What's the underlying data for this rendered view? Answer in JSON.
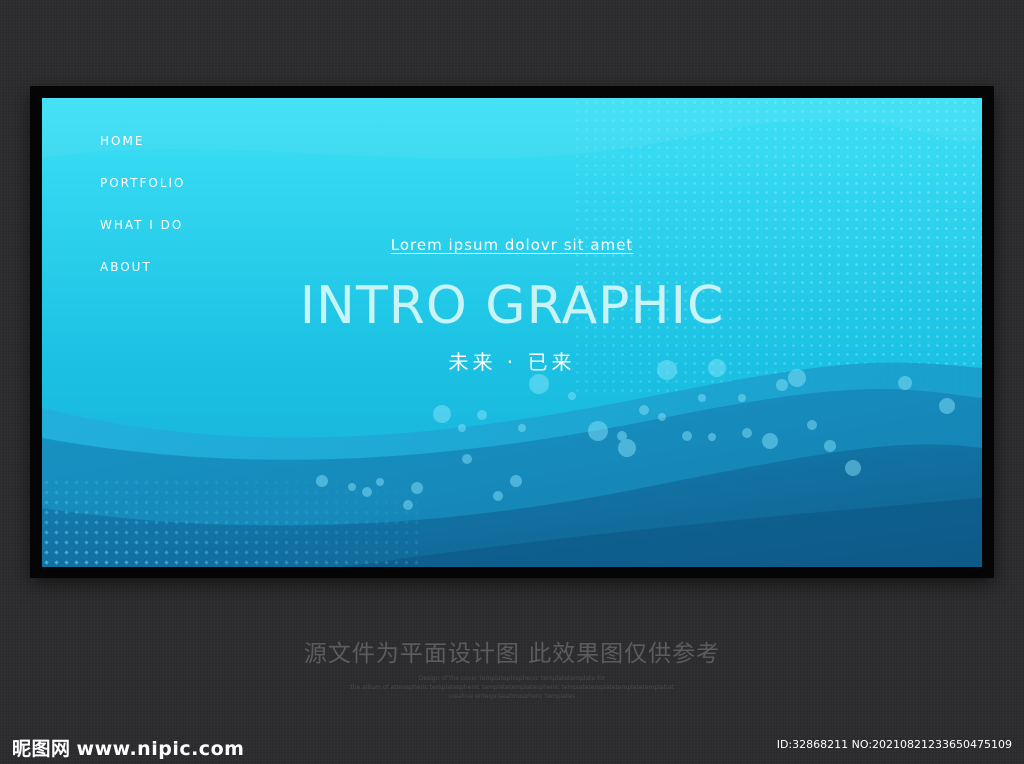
{
  "nav": {
    "items": [
      {
        "label": "HOME"
      },
      {
        "label": "PORTFOLIO"
      },
      {
        "label": "WHAT I DO"
      },
      {
        "label": "ABOUT"
      }
    ]
  },
  "hero": {
    "tagline": "Lorem ipsum dolovr sit amet",
    "title": "INTRO GRAPHIC",
    "subtitle": "未来 · 已来"
  },
  "footer": {
    "caption": "源文件为平面设计图 此效果图仅供参考",
    "fine_print": [
      "Design of the cover templatephisphenic templatetemplate for",
      "the album of atmospheric templatesphenic templatetemplatesphenic templatetemplatetemplatetemplatiat",
      "creative enterpriseatmospheric templates"
    ]
  },
  "watermark": {
    "logo_text": "昵图网",
    "url": "www.nipic.com",
    "image_id": "ID:32868211 NO:20210821233650475109"
  },
  "colors": {
    "sky_top": "#3ee0f6",
    "sky_mid": "#1bc2e3",
    "wave_deep": "#1676a6",
    "wave_dark": "#0f5f8e",
    "frame": "#050505",
    "page_bg": "#2b2b2d"
  }
}
